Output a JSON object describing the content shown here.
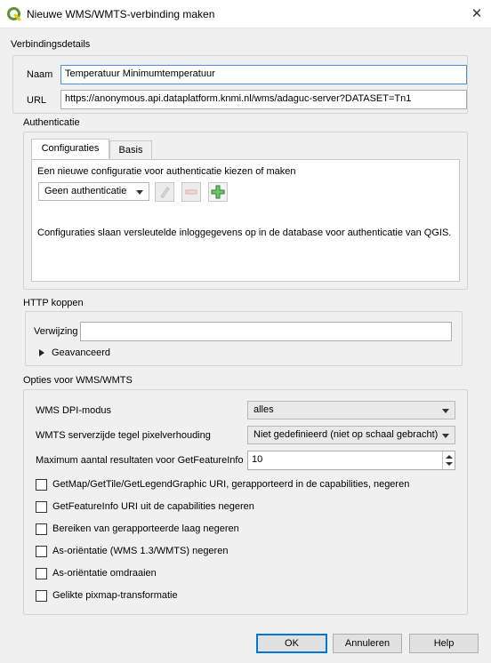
{
  "window": {
    "title": "Nieuwe WMS/WMTS-verbinding maken",
    "close_glyph": "✕"
  },
  "connection": {
    "section_label": "Verbindingsdetails",
    "name_label": "Naam",
    "name_value": "Temperatuur Minimumtemperatuur",
    "url_label": "URL",
    "url_value": "https://anonymous.api.dataplatform.knmi.nl/wms/adaguc-server?DATASET=Tn1"
  },
  "auth": {
    "section_label": "Authenticatie",
    "tabs": [
      {
        "label": "Configuraties",
        "active": true
      },
      {
        "label": "Basis",
        "active": false
      }
    ],
    "choose_text": "Een nieuwe configuratie voor authenticatie kiezen of maken",
    "combo_value": "Geen authenticatie",
    "info_text": "Configuraties slaan versleutelde inloggegevens op in de database voor authenticatie van QGIS."
  },
  "http": {
    "section_label": "HTTP koppen",
    "referer_label": "Verwijzing",
    "referer_value": "",
    "advanced_label": "Geavanceerd"
  },
  "options": {
    "section_label": "Opties voor WMS/WMTS",
    "dpi_label": "WMS DPI-modus",
    "dpi_value": "alles",
    "tile_label": "WMTS serverzijde tegel pixelverhouding",
    "tile_value": "Niet gedefinieerd (niet op schaal gebracht)",
    "max_label": "Maximum aantal resultaten voor GetFeatureInfo",
    "max_value": "10",
    "checkboxes": [
      {
        "label": "GetMap/GetTile/GetLegendGraphic URI, gerapporteerd in de capabilities, negeren",
        "checked": false
      },
      {
        "label": "GetFeatureInfo URI uit de capabilities negeren",
        "checked": false
      },
      {
        "label": "Bereiken van gerapporteerde laag negeren",
        "checked": false
      },
      {
        "label": "As-oriëntatie (WMS 1.3/WMTS) negeren",
        "checked": false
      },
      {
        "label": "As-oriëntatie omdraaien",
        "checked": false
      },
      {
        "label": "Gelikte pixmap-transformatie",
        "checked": false
      }
    ]
  },
  "buttons": {
    "ok": "OK",
    "cancel": "Annuleren",
    "help": "Help"
  },
  "colors": {
    "accent": "#0078d7",
    "qgis_green": "#589632",
    "add_green": "#3a9d3a"
  }
}
